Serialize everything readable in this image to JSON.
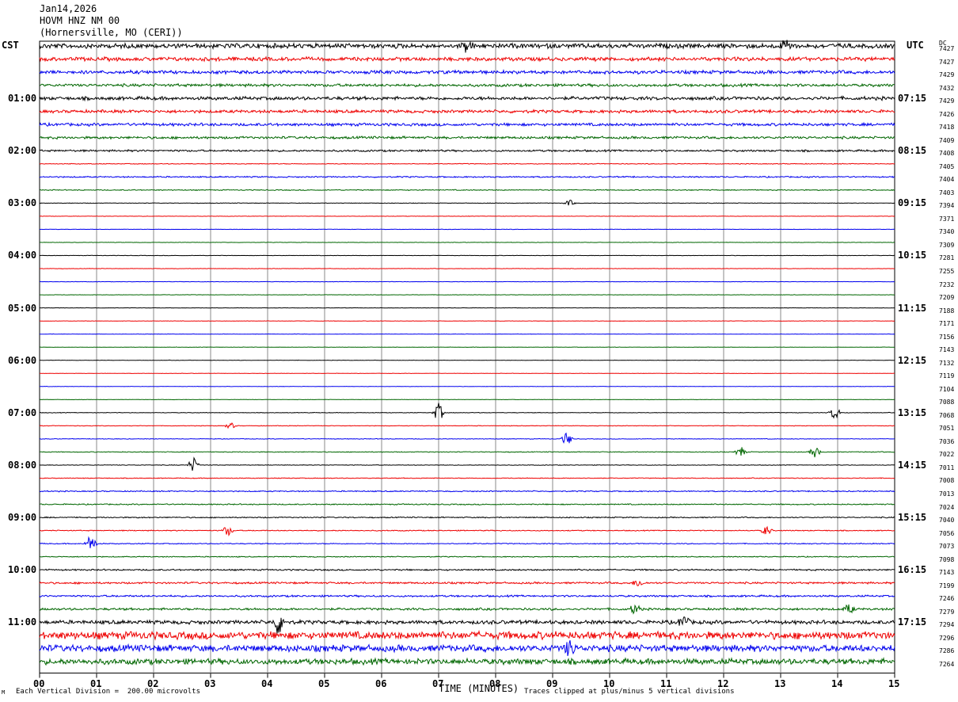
{
  "header": {
    "date": "Jan14,2026",
    "station": "HOVM HNZ NM 00",
    "location": "(Hornersville, MO (CERI))"
  },
  "left_axis_title": "CST",
  "right_axis_title": "UTC",
  "dc_title": "DC",
  "footer": {
    "corner_mark": "M",
    "scale_note": "Each Vertical Division =  200.00 microvolts",
    "xlabel": "TIME (MINUTES)",
    "clip_note": "Traces clipped at plus/minus 5 vertical divisions"
  },
  "colors": {
    "trace_cycle": [
      "#000000",
      "#ee0000",
      "#0000ee",
      "#006600"
    ],
    "grid": "#888888"
  },
  "chart_data": {
    "type": "line",
    "xlabel": "TIME (MINUTES)",
    "x_ticks": [
      "00",
      "01",
      "02",
      "03",
      "04",
      "05",
      "06",
      "07",
      "08",
      "09",
      "10",
      "11",
      "12",
      "13",
      "14",
      "15"
    ],
    "xlim": [
      0,
      15
    ],
    "cst_labels": [
      "01:00",
      "02:00",
      "03:00",
      "04:00",
      "05:00",
      "06:00",
      "07:00",
      "08:00",
      "09:00",
      "10:00",
      "11:00"
    ],
    "utc_labels": [
      "07:15",
      "08:15",
      "09:15",
      "10:15",
      "11:15",
      "12:15",
      "13:15",
      "14:15",
      "15:15",
      "16:15",
      "17:15"
    ],
    "dc_offsets": [
      7427,
      7427,
      7429,
      7432,
      7429,
      7426,
      7418,
      7409,
      7408,
      7405,
      7404,
      7403,
      7394,
      7371,
      7340,
      7309,
      7281,
      7255,
      7232,
      7209,
      7188,
      7171,
      7156,
      7143,
      7132,
      7119,
      7104,
      7088,
      7068,
      7051,
      7036,
      7022,
      7011,
      7008,
      7013,
      7024,
      7040,
      7056,
      7073,
      7098,
      7143,
      7199,
      7246,
      7279,
      7294,
      7296,
      7286,
      7264
    ],
    "noise_level": [
      2.5,
      2.0,
      1.8,
      1.5,
      1.8,
      1.6,
      1.5,
      1.3,
      1.0,
      0.4,
      0.7,
      0.5,
      0.3,
      0.2,
      0.2,
      0.2,
      0.2,
      0.2,
      0.2,
      0.2,
      0.2,
      0.2,
      0.2,
      0.2,
      0.2,
      0.2,
      0.2,
      0.2,
      0.3,
      0.3,
      0.3,
      0.4,
      0.3,
      0.4,
      0.6,
      0.6,
      0.6,
      0.5,
      0.5,
      0.5,
      0.8,
      1.0,
      1.0,
      1.2,
      2.0,
      4.0,
      3.5,
      3.0
    ],
    "events": [
      {
        "trace": 0,
        "minute": 7.5,
        "amp": 8
      },
      {
        "trace": 0,
        "minute": 13.1,
        "amp": 9
      },
      {
        "trace": 12,
        "minute": 9.3,
        "amp": 4
      },
      {
        "trace": 28,
        "minute": 7.0,
        "amp": 12
      },
      {
        "trace": 28,
        "minute": 13.95,
        "amp": 9
      },
      {
        "trace": 29,
        "minute": 3.35,
        "amp": 4
      },
      {
        "trace": 30,
        "minute": 9.25,
        "amp": 9
      },
      {
        "trace": 31,
        "minute": 12.3,
        "amp": 7
      },
      {
        "trace": 31,
        "minute": 13.6,
        "amp": 7
      },
      {
        "trace": 32,
        "minute": 2.7,
        "amp": 10
      },
      {
        "trace": 37,
        "minute": 3.3,
        "amp": 7
      },
      {
        "trace": 37,
        "minute": 12.75,
        "amp": 6
      },
      {
        "trace": 38,
        "minute": 0.9,
        "amp": 12
      },
      {
        "trace": 41,
        "minute": 10.5,
        "amp": 5
      },
      {
        "trace": 43,
        "minute": 10.45,
        "amp": 7
      },
      {
        "trace": 43,
        "minute": 14.2,
        "amp": 6
      },
      {
        "trace": 44,
        "minute": 4.2,
        "amp": 18
      },
      {
        "trace": 44,
        "minute": 11.3,
        "amp": 9
      },
      {
        "trace": 46,
        "minute": 9.3,
        "amp": 10
      }
    ]
  }
}
